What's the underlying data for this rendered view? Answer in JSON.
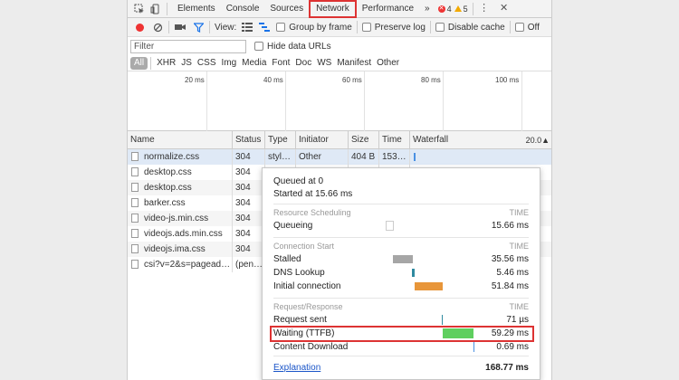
{
  "tabs": {
    "items": [
      "Elements",
      "Console",
      "Sources",
      "Network",
      "Performance"
    ],
    "more": "»",
    "error_count": "4",
    "warning_count": "5",
    "menu": "⋮",
    "close": "✕"
  },
  "toolbar": {
    "view_label": "View:",
    "group_by_frame": "Group by frame",
    "preserve_log": "Preserve log",
    "disable_cache": "Disable cache",
    "offline": "Off"
  },
  "filter": {
    "placeholder": "Filter",
    "hide_data_urls": "Hide data URLs"
  },
  "types": [
    "All",
    "XHR",
    "JS",
    "CSS",
    "Img",
    "Media",
    "Font",
    "Doc",
    "WS",
    "Manifest",
    "Other"
  ],
  "overview_ticks": [
    "20 ms",
    "40 ms",
    "60 ms",
    "80 ms",
    "100 ms"
  ],
  "columns": {
    "name": "Name",
    "status": "Status",
    "type": "Type",
    "initiator": "Initiator",
    "size": "Size",
    "time": "Time",
    "waterfall": "Waterfall",
    "sort": "20.0▲"
  },
  "rows": [
    {
      "name": "normalize.css",
      "status": "304",
      "type": "styl…",
      "initiator": "Other",
      "size": "404 B",
      "time": "153…"
    },
    {
      "name": "desktop.css",
      "status": "304",
      "type": "",
      "initiator": "",
      "size": "",
      "time": ""
    },
    {
      "name": "desktop.css",
      "status": "304",
      "type": "",
      "initiator": "",
      "size": "",
      "time": ""
    },
    {
      "name": "barker.css",
      "status": "304",
      "type": "",
      "initiator": "",
      "size": "",
      "time": ""
    },
    {
      "name": "video-js.min.css",
      "status": "304",
      "type": "",
      "initiator": "",
      "size": "",
      "time": ""
    },
    {
      "name": "videojs.ads.min.css",
      "status": "304",
      "type": "",
      "initiator": "",
      "size": "",
      "time": ""
    },
    {
      "name": "videojs.ima.css",
      "status": "304",
      "type": "",
      "initiator": "",
      "size": "",
      "time": ""
    },
    {
      "name": "csi?v=2&s=pagead…",
      "status": "(pen…",
      "type": "",
      "initiator": "",
      "size": "",
      "time": ""
    }
  ],
  "timing": {
    "queued_at": "Queued at 0",
    "started_at": "Started at 15.66 ms",
    "time_header": "TIME",
    "sections": [
      {
        "title": "Resource Scheduling",
        "items": [
          {
            "label": "Queueing",
            "value": "15.66 ms"
          }
        ]
      },
      {
        "title": "Connection Start",
        "items": [
          {
            "label": "Stalled",
            "value": "35.56 ms"
          },
          {
            "label": "DNS Lookup",
            "value": "5.46 ms"
          },
          {
            "label": "Initial connection",
            "value": "51.84 ms"
          }
        ]
      },
      {
        "title": "Request/Response",
        "items": [
          {
            "label": "Request sent",
            "value": "71 µs"
          },
          {
            "label": "Waiting (TTFB)",
            "value": "59.29 ms"
          },
          {
            "label": "Content Download",
            "value": "0.69 ms"
          }
        ]
      }
    ],
    "explanation": "Explanation",
    "total": "168.77 ms",
    "colors": {
      "stalled": "#a6a6a6",
      "dns": "#2f8aa0",
      "connection": "#e8963a",
      "waiting": "#5fcf5f",
      "download": "#4a90e2"
    }
  }
}
